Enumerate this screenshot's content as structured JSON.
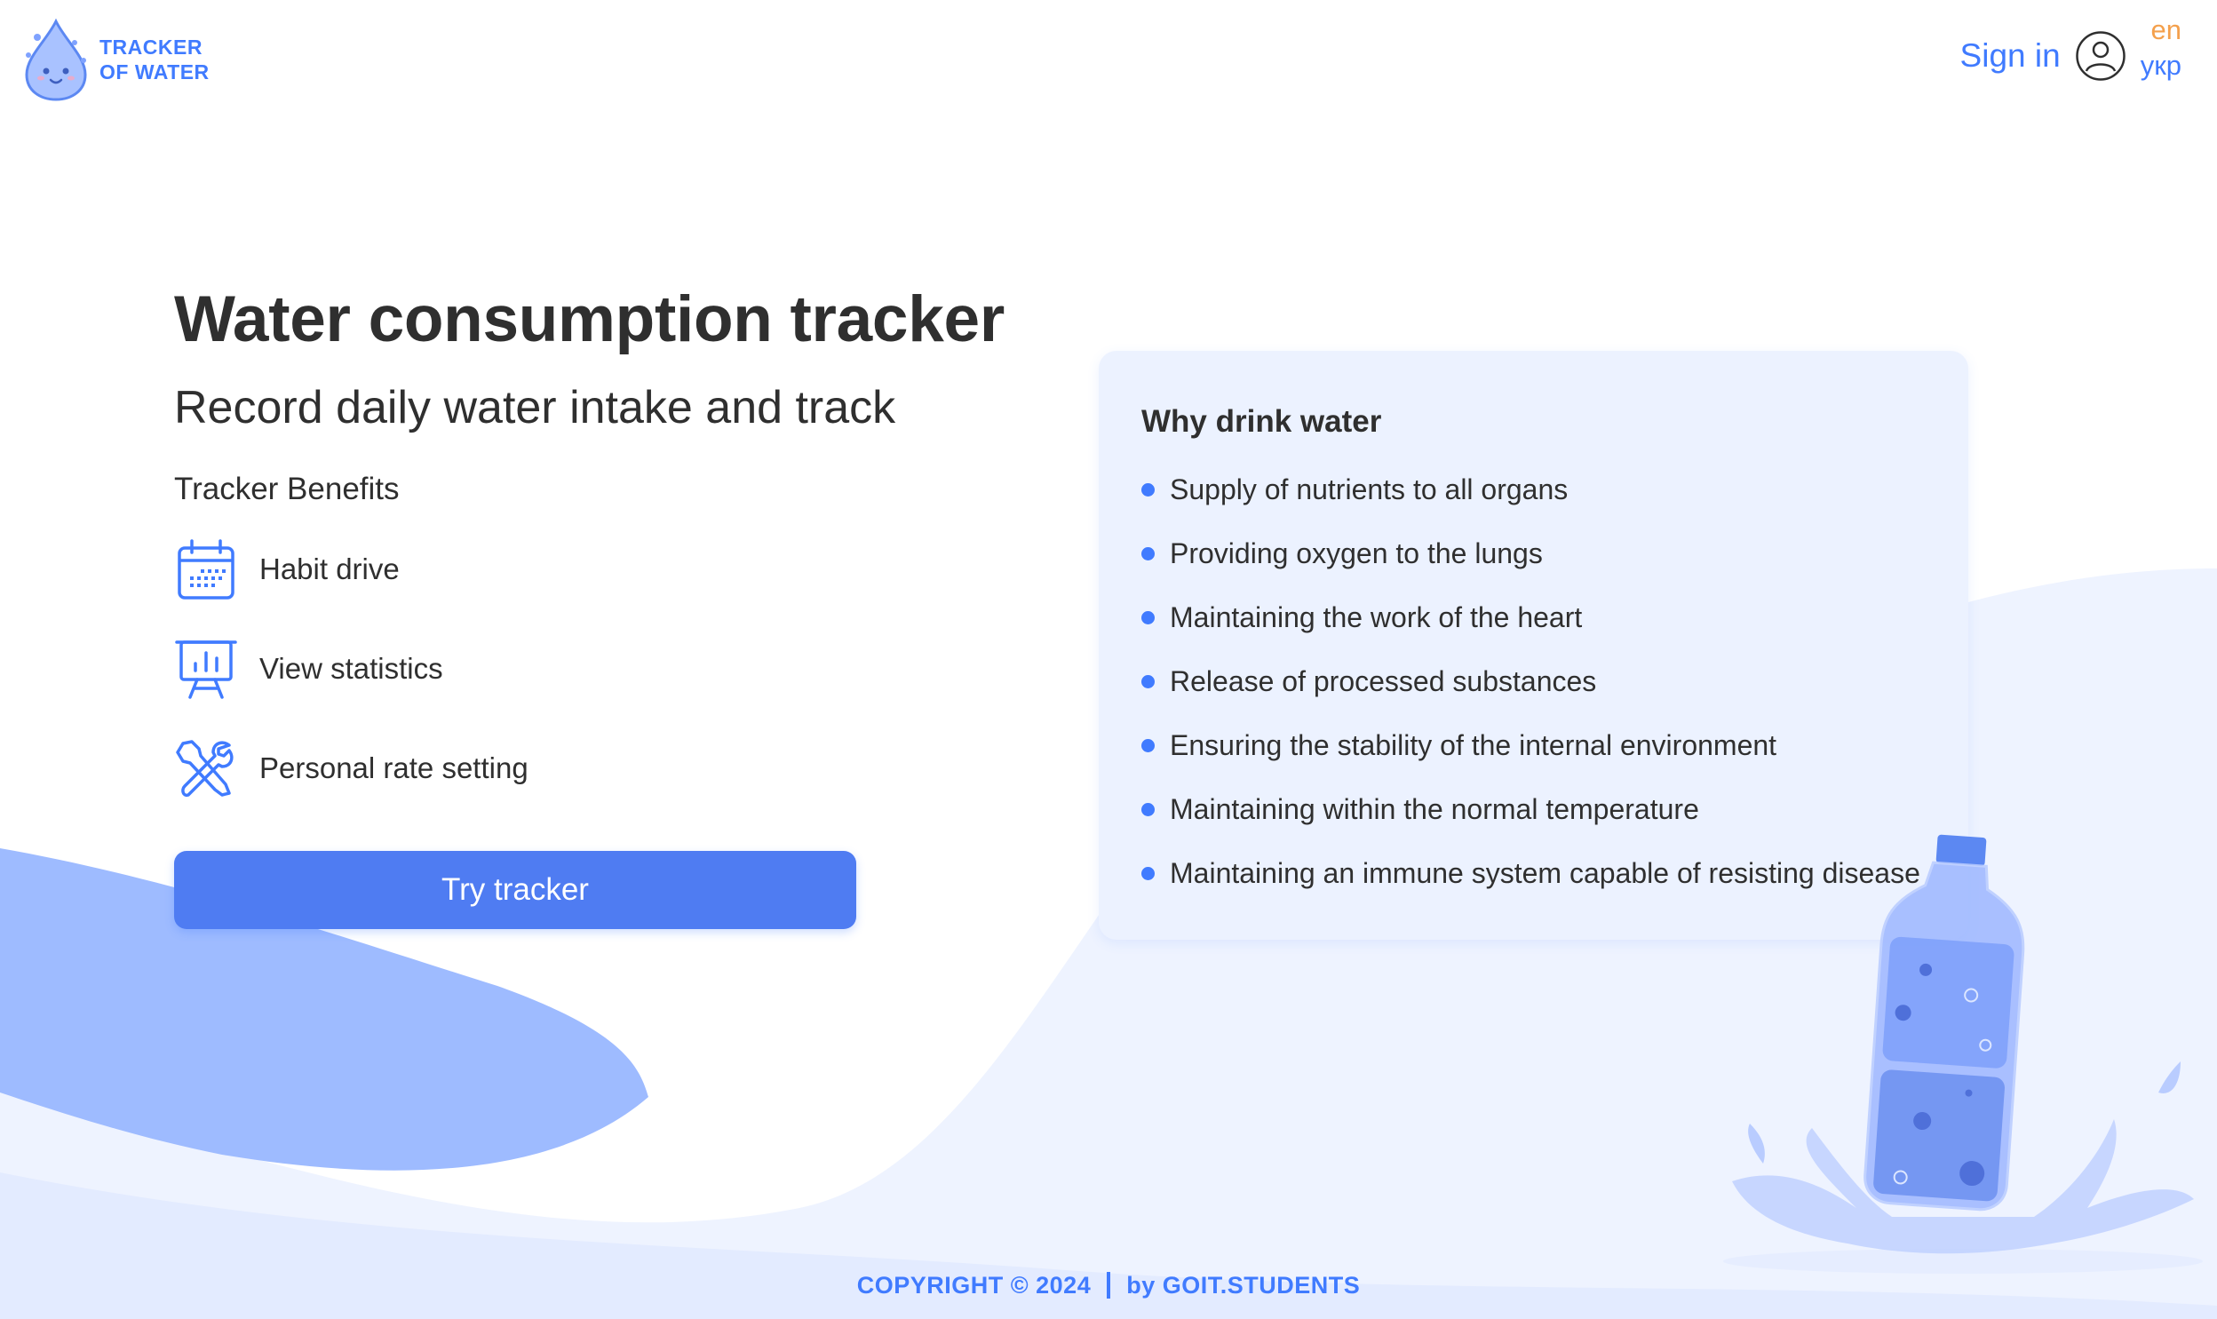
{
  "header": {
    "logo_line1": "TRACKER",
    "logo_line2": "OF WATER",
    "sign_in": "Sign in",
    "lang_active": "en",
    "lang_other": "укр"
  },
  "hero": {
    "title": "Water consumption tracker",
    "subtitle": "Record daily water intake and track",
    "benefits_title": "Tracker Benefits",
    "benefits": [
      {
        "label": "Habit drive",
        "icon": "calendar-icon"
      },
      {
        "label": "View statistics",
        "icon": "presentation-chart-icon"
      },
      {
        "label": "Personal rate setting",
        "icon": "tools-icon"
      }
    ],
    "cta": "Try tracker"
  },
  "why": {
    "title": "Why drink water",
    "items": [
      "Supply of nutrients to all organs",
      "Providing oxygen to the lungs",
      "Maintaining the work of the heart",
      "Release of processed substances",
      "Ensuring the stability of the internal environment",
      "Maintaining within the normal temperature",
      "Maintaining an immune system capable of resisting disease"
    ]
  },
  "footer": {
    "copyright": "COPYRIGHT © 2024",
    "by": "by GOIT.STUDENTS"
  },
  "colors": {
    "accent": "#407BFF",
    "button": "#4F7CF2",
    "lang_active": "#F4A04C",
    "card_bg": "#ECF2FF",
    "wave_light": "#E3EBFF",
    "wave_dark": "#9EBBFF"
  }
}
